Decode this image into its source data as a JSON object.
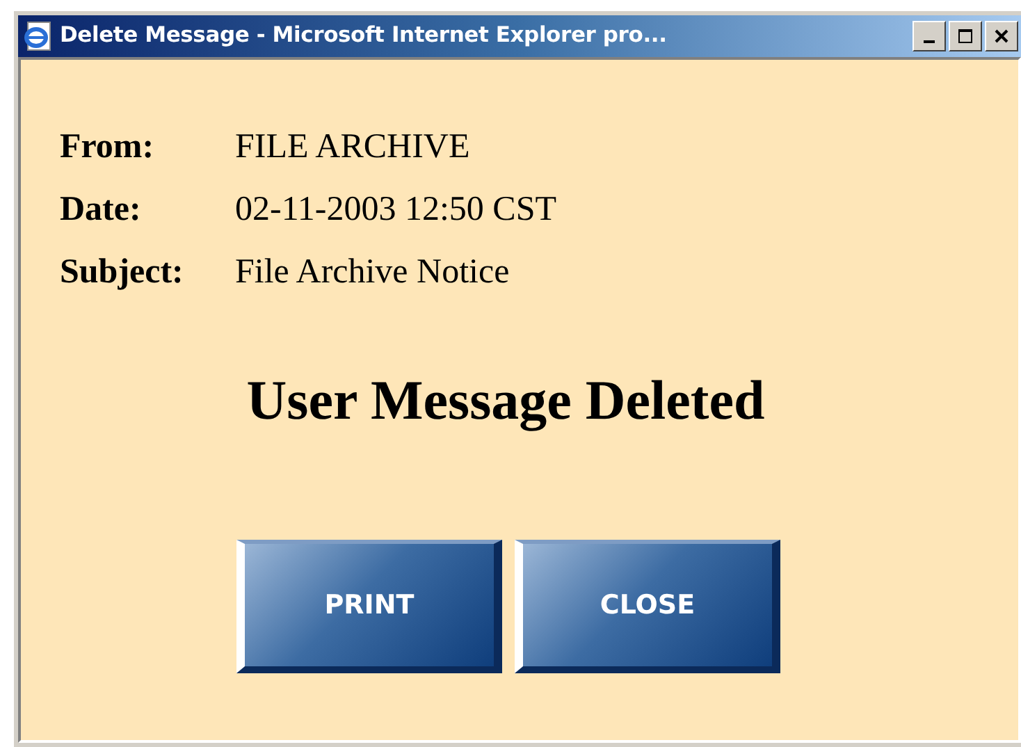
{
  "window": {
    "title": "Delete Message - Microsoft Internet Explorer pro..."
  },
  "fields": [
    {
      "label": "From:",
      "value": "FILE ARCHIVE"
    },
    {
      "label": "Date:",
      "value": "02-11-2003 12:50 CST"
    },
    {
      "label": "Subject:",
      "value": "File Archive Notice"
    }
  ],
  "heading": "User Message Deleted",
  "buttons": [
    "PRINT",
    "CLOSE"
  ]
}
